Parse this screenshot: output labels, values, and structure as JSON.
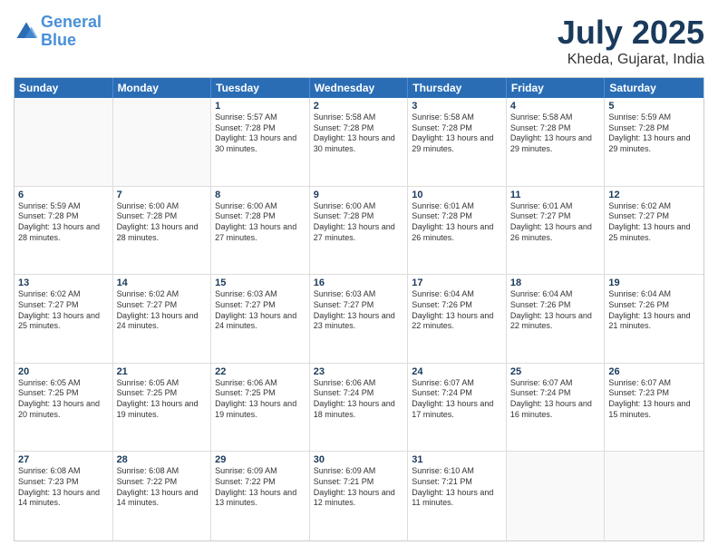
{
  "header": {
    "logo_line1": "General",
    "logo_line2": "Blue",
    "month": "July 2025",
    "location": "Kheda, Gujarat, India"
  },
  "weekdays": [
    "Sunday",
    "Monday",
    "Tuesday",
    "Wednesday",
    "Thursday",
    "Friday",
    "Saturday"
  ],
  "weeks": [
    [
      {
        "day": "",
        "info": ""
      },
      {
        "day": "",
        "info": ""
      },
      {
        "day": "1",
        "info": "Sunrise: 5:57 AM\nSunset: 7:28 PM\nDaylight: 13 hours and 30 minutes."
      },
      {
        "day": "2",
        "info": "Sunrise: 5:58 AM\nSunset: 7:28 PM\nDaylight: 13 hours and 30 minutes."
      },
      {
        "day": "3",
        "info": "Sunrise: 5:58 AM\nSunset: 7:28 PM\nDaylight: 13 hours and 29 minutes."
      },
      {
        "day": "4",
        "info": "Sunrise: 5:58 AM\nSunset: 7:28 PM\nDaylight: 13 hours and 29 minutes."
      },
      {
        "day": "5",
        "info": "Sunrise: 5:59 AM\nSunset: 7:28 PM\nDaylight: 13 hours and 29 minutes."
      }
    ],
    [
      {
        "day": "6",
        "info": "Sunrise: 5:59 AM\nSunset: 7:28 PM\nDaylight: 13 hours and 28 minutes."
      },
      {
        "day": "7",
        "info": "Sunrise: 6:00 AM\nSunset: 7:28 PM\nDaylight: 13 hours and 28 minutes."
      },
      {
        "day": "8",
        "info": "Sunrise: 6:00 AM\nSunset: 7:28 PM\nDaylight: 13 hours and 27 minutes."
      },
      {
        "day": "9",
        "info": "Sunrise: 6:00 AM\nSunset: 7:28 PM\nDaylight: 13 hours and 27 minutes."
      },
      {
        "day": "10",
        "info": "Sunrise: 6:01 AM\nSunset: 7:28 PM\nDaylight: 13 hours and 26 minutes."
      },
      {
        "day": "11",
        "info": "Sunrise: 6:01 AM\nSunset: 7:27 PM\nDaylight: 13 hours and 26 minutes."
      },
      {
        "day": "12",
        "info": "Sunrise: 6:02 AM\nSunset: 7:27 PM\nDaylight: 13 hours and 25 minutes."
      }
    ],
    [
      {
        "day": "13",
        "info": "Sunrise: 6:02 AM\nSunset: 7:27 PM\nDaylight: 13 hours and 25 minutes."
      },
      {
        "day": "14",
        "info": "Sunrise: 6:02 AM\nSunset: 7:27 PM\nDaylight: 13 hours and 24 minutes."
      },
      {
        "day": "15",
        "info": "Sunrise: 6:03 AM\nSunset: 7:27 PM\nDaylight: 13 hours and 24 minutes."
      },
      {
        "day": "16",
        "info": "Sunrise: 6:03 AM\nSunset: 7:27 PM\nDaylight: 13 hours and 23 minutes."
      },
      {
        "day": "17",
        "info": "Sunrise: 6:04 AM\nSunset: 7:26 PM\nDaylight: 13 hours and 22 minutes."
      },
      {
        "day": "18",
        "info": "Sunrise: 6:04 AM\nSunset: 7:26 PM\nDaylight: 13 hours and 22 minutes."
      },
      {
        "day": "19",
        "info": "Sunrise: 6:04 AM\nSunset: 7:26 PM\nDaylight: 13 hours and 21 minutes."
      }
    ],
    [
      {
        "day": "20",
        "info": "Sunrise: 6:05 AM\nSunset: 7:25 PM\nDaylight: 13 hours and 20 minutes."
      },
      {
        "day": "21",
        "info": "Sunrise: 6:05 AM\nSunset: 7:25 PM\nDaylight: 13 hours and 19 minutes."
      },
      {
        "day": "22",
        "info": "Sunrise: 6:06 AM\nSunset: 7:25 PM\nDaylight: 13 hours and 19 minutes."
      },
      {
        "day": "23",
        "info": "Sunrise: 6:06 AM\nSunset: 7:24 PM\nDaylight: 13 hours and 18 minutes."
      },
      {
        "day": "24",
        "info": "Sunrise: 6:07 AM\nSunset: 7:24 PM\nDaylight: 13 hours and 17 minutes."
      },
      {
        "day": "25",
        "info": "Sunrise: 6:07 AM\nSunset: 7:24 PM\nDaylight: 13 hours and 16 minutes."
      },
      {
        "day": "26",
        "info": "Sunrise: 6:07 AM\nSunset: 7:23 PM\nDaylight: 13 hours and 15 minutes."
      }
    ],
    [
      {
        "day": "27",
        "info": "Sunrise: 6:08 AM\nSunset: 7:23 PM\nDaylight: 13 hours and 14 minutes."
      },
      {
        "day": "28",
        "info": "Sunrise: 6:08 AM\nSunset: 7:22 PM\nDaylight: 13 hours and 14 minutes."
      },
      {
        "day": "29",
        "info": "Sunrise: 6:09 AM\nSunset: 7:22 PM\nDaylight: 13 hours and 13 minutes."
      },
      {
        "day": "30",
        "info": "Sunrise: 6:09 AM\nSunset: 7:21 PM\nDaylight: 13 hours and 12 minutes."
      },
      {
        "day": "31",
        "info": "Sunrise: 6:10 AM\nSunset: 7:21 PM\nDaylight: 13 hours and 11 minutes."
      },
      {
        "day": "",
        "info": ""
      },
      {
        "day": "",
        "info": ""
      }
    ]
  ]
}
